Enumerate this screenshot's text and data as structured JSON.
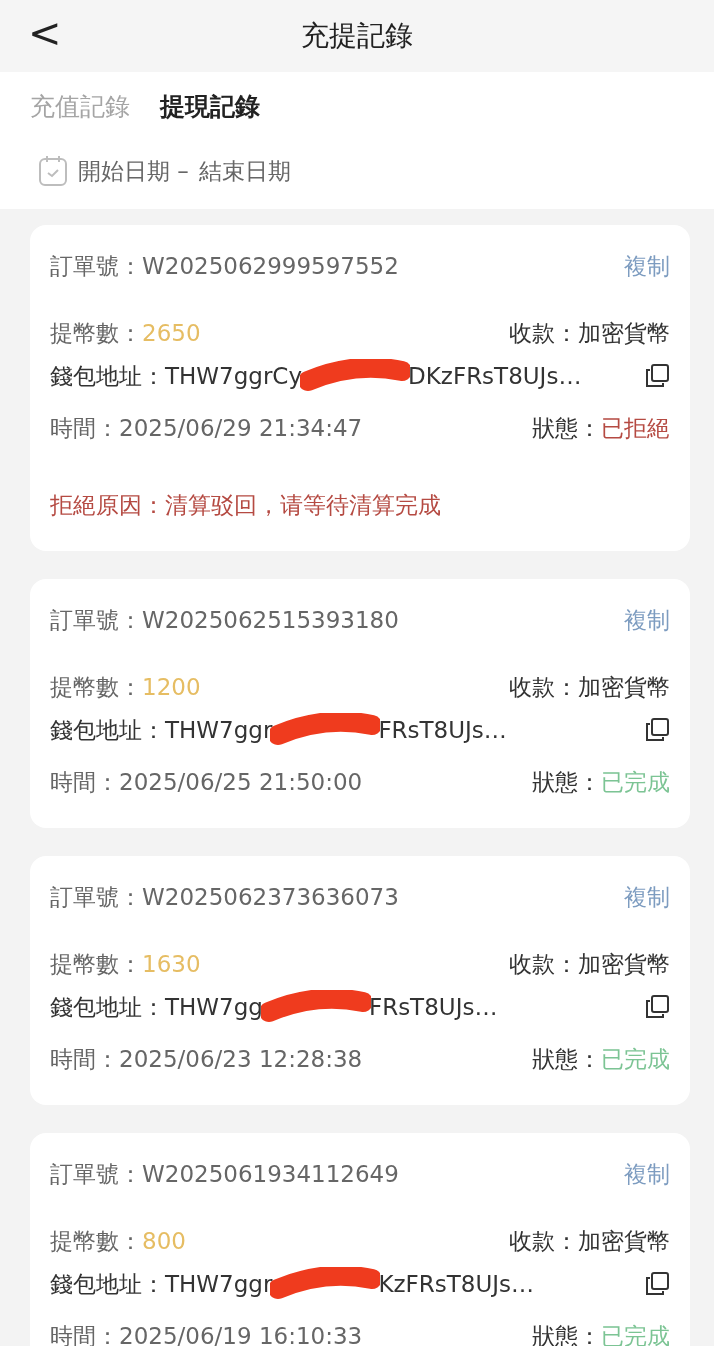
{
  "header": {
    "back": "<",
    "title": "充提記錄"
  },
  "tabs": [
    {
      "label": "充值記錄",
      "selected": false
    },
    {
      "label": "提現記錄",
      "selected": true
    }
  ],
  "date_range": {
    "start": "開始日期 –",
    "end": "結束日期"
  },
  "records": [
    {
      "order_label": "訂單號：",
      "order": "W2025062999597552",
      "copy": "複制",
      "amount_label": "提幣數：",
      "amount": "2650",
      "payee_label": "收款：",
      "payee": "加密貨幣",
      "address_label": "錢包地址：",
      "address_start": "THW7ggrCy",
      "address_end": "DKzFRsT8UJs…",
      "time_label": "時間：",
      "time": "2025/06/29 21:34:47",
      "status_label": "狀態：",
      "status": "已拒絕",
      "kind": "rejected",
      "reason": "拒絕原因：清算驳回，请等待清算完成"
    },
    {
      "order_label": "訂單號：",
      "order": "W2025062515393180",
      "copy": "複制",
      "amount_label": "提幣數：",
      "amount": "1200",
      "payee_label": "收款：",
      "payee": "加密貨幣",
      "address_label": "錢包地址：",
      "address_start": "THW7ggr",
      "address_end": "FRsT8UJs…",
      "time_label": "時間：",
      "time": "2025/06/25 21:50:00",
      "status_label": "狀態：",
      "status": "已完成",
      "kind": "done"
    },
    {
      "order_label": "訂單號：",
      "order": "W2025062373636073",
      "copy": "複制",
      "amount_label": "提幣數：",
      "amount": "1630",
      "payee_label": "收款：",
      "payee": "加密貨幣",
      "address_label": "錢包地址：",
      "address_start": "THW7gg",
      "address_end": "FRsT8UJs…",
      "time_label": "時間：",
      "time": "2025/06/23 12:28:38",
      "status_label": "狀態：",
      "status": "已完成",
      "kind": "done"
    },
    {
      "order_label": "訂單號：",
      "order": "W2025061934112649",
      "copy": "複制",
      "amount_label": "提幣數：",
      "amount": "800",
      "payee_label": "收款：",
      "payee": "加密貨幣",
      "address_label": "錢包地址：",
      "address_start": "THW7ggr",
      "address_end": "KzFRsT8UJs…",
      "time_label": "時間：",
      "time": "2025/06/19 16:10:33",
      "status_label": "狀態：",
      "status": "已完成",
      "kind": "done"
    }
  ]
}
